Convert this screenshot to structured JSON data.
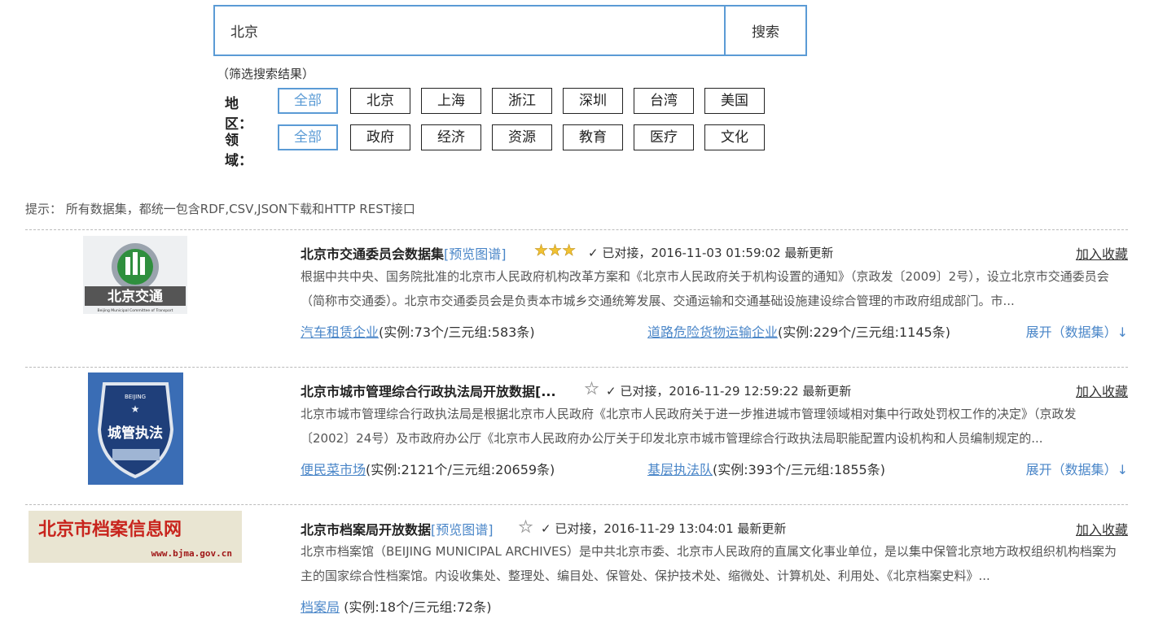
{
  "search": {
    "value": "北京",
    "button_label": "搜索"
  },
  "filters": {
    "hint": "（筛选搜索结果）",
    "region_label": "地区：",
    "regions": [
      "全部",
      "北京",
      "上海",
      "浙江",
      "深圳",
      "台湾",
      "美国"
    ],
    "field_label": "领域：",
    "fields": [
      "全部",
      "政府",
      "经济",
      "资源",
      "教育",
      "医疗",
      "文化"
    ],
    "active_region": "全部",
    "active_field": "全部"
  },
  "tip": "提示： 所有数据集，都统一包含RDF,CSV,JSON下载和HTTP REST接口",
  "results": [
    {
      "title": "北京市交通委员会数据集",
      "preview": "[预览图谱]",
      "stars": 3,
      "status": "✓ 已对接，2016-11-03 01:59:02 最新更新",
      "favorite": "加入收藏",
      "description": "根据中共中央、国务院批准的北京市人民政府机构改革方案和《北京市人民政府关于机构设置的通知》（京政发〔2009〕2号），设立北京市交通委员会（简称市交通委）。北京市交通委员会是负责本市城乡交通统筹发展、交通运输和交通基础设施建设综合管理的市政府组成部门。市...",
      "stat1_link": "汽车租赁企业",
      "stat1_text": "(实例:73个/三元组:583条)",
      "stat2_link": "道路危险货物运输企业",
      "stat2_text": "(实例:229个/三元组:1145条)",
      "expand": "展开（数据集）↓",
      "logo_text": "北京交通",
      "logo_sub": "Beijing Municipal Committee of Transport"
    },
    {
      "title": "北京市城市管理综合行政执法局开放数据[...",
      "preview": "",
      "stars": 0,
      "status": "✓ 已对接，2016-11-29 12:59:22 最新更新",
      "favorite": "加入收藏",
      "description": "北京市城市管理综合行政执法局是根据北京市人民政府《北京市人民政府关于进一步推进城市管理领域相对集中行政处罚权工作的决定》（京政发〔2002〕24号）及市政府办公厅《北京市人民政府办公厅关于印发北京市城市管理综合行政执法局职能配置内设机构和人员编制规定的...",
      "stat1_link": "便民菜市场",
      "stat1_text": "(实例:2121个/三元组:20659条)",
      "stat2_link": "基层执法队",
      "stat2_text": "(实例:393个/三元组:1855条)",
      "expand": "展开（数据集）↓",
      "logo_text": "城管执法",
      "logo_sub": "BEIJING"
    },
    {
      "title": "北京市档案局开放数据",
      "preview": "[预览图谱]",
      "stars": 0,
      "status": "✓ 已对接，2016-11-29 13:04:01 最新更新",
      "favorite": "加入收藏",
      "description": "北京市档案馆（BEIJING MUNICIPAL ARCHIVES）是中共北京市委、北京市人民政府的直属文化事业单位，是以集中保管北京地方政权组织机构档案为主的国家综合性档案馆。内设收集处、整理处、编目处、保管处、保护技术处、缩微处、计算机处、利用处、《北京档案史料》...",
      "stat1_link": "档案局",
      "stat1_text": " (实例:18个/三元组:72条)",
      "stat2_link": "",
      "stat2_text": "",
      "expand": "",
      "logo_text": "北京市档案信息网",
      "logo_sub": "www.bjma.gov.cn"
    }
  ],
  "colors": {
    "accent": "#5b9bd5",
    "link": "#4a86c8",
    "star": "#f1c232"
  },
  "icons": [
    "star-icon",
    "check-icon",
    "arrow-down-icon"
  ]
}
